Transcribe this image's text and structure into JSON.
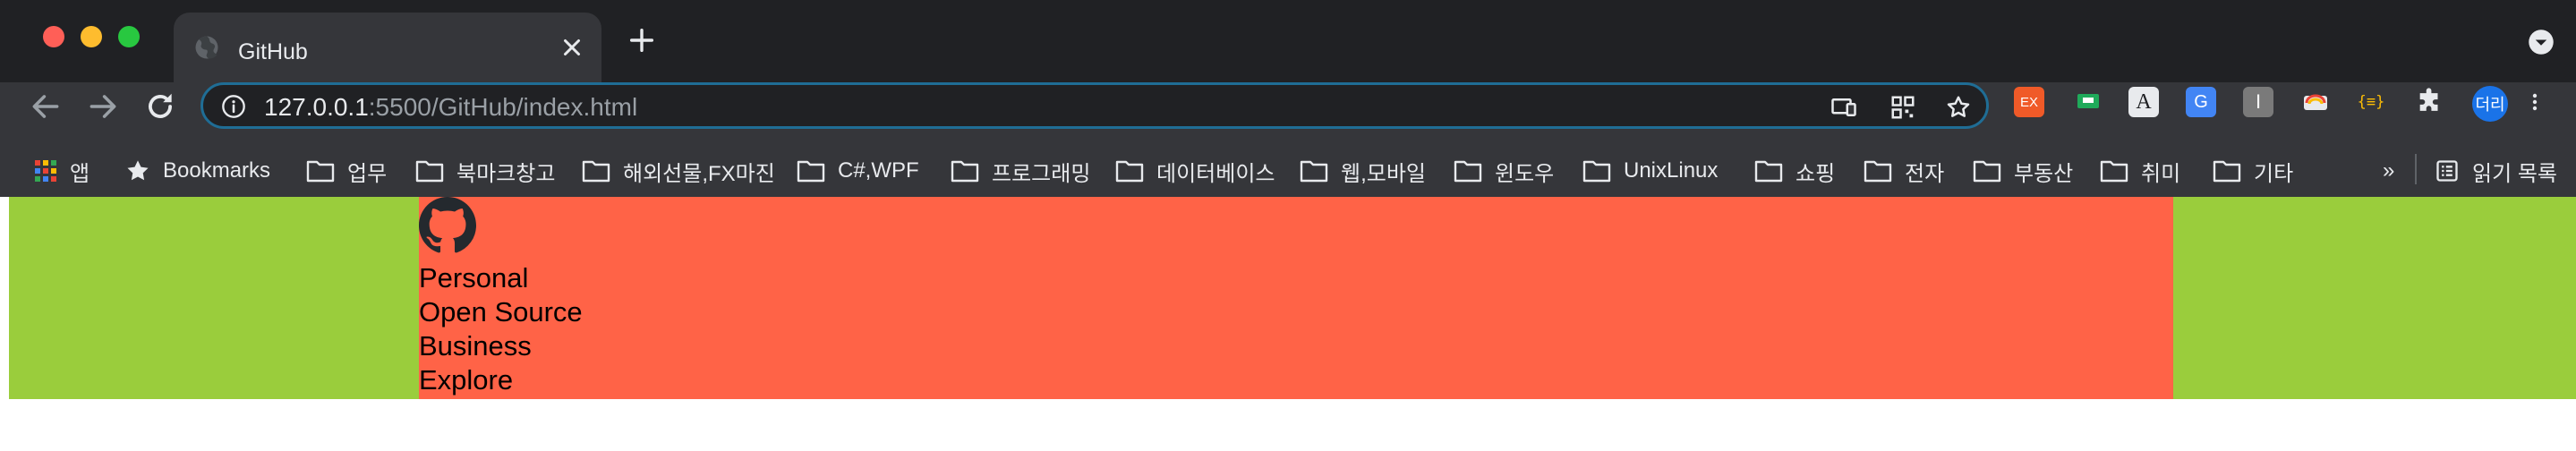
{
  "window": {
    "tab": {
      "title": "GitHub",
      "favicon": "globe-icon"
    },
    "newtab_icon": "plus-icon",
    "tabmenu_icon": "chevron-down-icon"
  },
  "toolbar": {
    "url_host": "127.0.0.1",
    "url_rest": ":5500/GitHub/index.html",
    "avatar_label": "더리",
    "extensions": [
      "EX",
      "",
      "A",
      "G",
      "I",
      "",
      "{≡}"
    ]
  },
  "bookmarks": {
    "apps_label": "앱",
    "items": [
      "Bookmarks",
      "업무",
      "북마크창고",
      "해외선물,FX마진",
      "C#,WPF",
      "프로그래밍",
      "데이터베이스",
      "웹,모바일",
      "윈도우",
      "UnixLinux",
      "쇼핑",
      "전자",
      "부동산",
      "취미",
      "기타"
    ],
    "more": "»",
    "reading_list": "읽기 목록"
  },
  "page": {
    "logo": "github-octocat-icon",
    "menu": [
      "Personal",
      "Open Source",
      "Business",
      "Explore"
    ],
    "colors": {
      "outer": "#9acd3c",
      "inner": "#ff6347"
    }
  }
}
